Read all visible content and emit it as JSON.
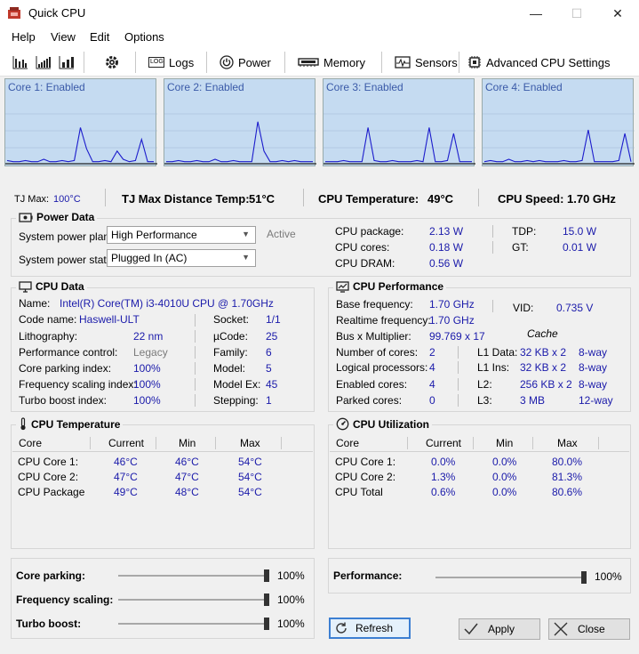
{
  "window": {
    "title": "Quick CPU",
    "minimize": "—",
    "maximize": "☐",
    "close": "✕"
  },
  "menu": [
    "Help",
    "View",
    "Edit",
    "Options"
  ],
  "toolbar": {
    "logs": "Logs",
    "power": "Power",
    "memory": "Memory",
    "sensors": "Sensors",
    "advanced": "Advanced CPU Settings",
    "log_badge": "LOG"
  },
  "cores": [
    {
      "label": "Core 1: Enabled",
      "load": [
        2,
        1,
        1,
        2,
        1,
        1,
        3,
        1,
        1,
        2,
        1,
        2,
        30,
        12,
        1,
        1,
        2,
        1,
        10,
        3,
        1,
        2,
        20,
        1,
        1
      ]
    },
    {
      "label": "Core 2: Enabled",
      "load": [
        1,
        1,
        2,
        1,
        1,
        2,
        1,
        1,
        3,
        1,
        1,
        2,
        1,
        1,
        1,
        35,
        10,
        1,
        1,
        2,
        1,
        2,
        1,
        1,
        1
      ]
    },
    {
      "label": "Core 3: Enabled",
      "load": [
        1,
        1,
        1,
        2,
        1,
        1,
        1,
        30,
        2,
        1,
        1,
        2,
        1,
        1,
        1,
        2,
        1,
        30,
        1,
        1,
        2,
        25,
        1,
        1,
        1
      ]
    },
    {
      "label": "Core 4: Enabled",
      "load": [
        1,
        2,
        1,
        1,
        3,
        1,
        1,
        2,
        1,
        2,
        1,
        1,
        1,
        2,
        1,
        1,
        2,
        28,
        1,
        1,
        1,
        1,
        2,
        25,
        1
      ]
    }
  ],
  "status": {
    "tjmax_label": "TJ Max:",
    "tjmax_value": "100°C",
    "tjdist_label": "TJ Max Distance Temp:",
    "tjdist_value": "51°C",
    "cputemp_label": "CPU Temperature:",
    "cputemp_value": "49°C",
    "cpuspeed_label": "CPU Speed:",
    "cpuspeed_value": "1.70 GHz"
  },
  "power": {
    "title": "Power Data",
    "plan_label": "System power plan:",
    "plan_value": "High Performance",
    "active": "Active",
    "state_label": "System power state:",
    "state_value": "Plugged In (AC)",
    "package_label": "CPU package:",
    "package_value": "2.13 W",
    "cores_label": "CPU cores:",
    "cores_value": "0.18 W",
    "dram_label": "CPU DRAM:",
    "dram_value": "0.56 W",
    "tdp_label": "TDP:",
    "tdp_value": "15.0 W",
    "gt_label": "GT:",
    "gt_value": "0.01 W"
  },
  "cpudata": {
    "title": "CPU Data",
    "name_label": "Name:",
    "name_value": "Intel(R) Core(TM) i3-4010U CPU @ 1.70GHz",
    "codename_label": "Code name:",
    "codename_value": "Haswell-ULT",
    "litho_label": "Lithography:",
    "litho_value": "22 nm",
    "perfctl_label": "Performance control:",
    "perfctl_value": "Legacy",
    "parking_label": "Core parking index:",
    "parking_value": "100%",
    "freq_label": "Frequency scaling index:",
    "freq_value": "100%",
    "turbo_label": "Turbo boost index:",
    "turbo_value": "100%",
    "socket_label": "Socket:",
    "socket_value": "1/1",
    "ucode_label": "µCode:",
    "ucode_value": "25",
    "family_label": "Family:",
    "family_value": "6",
    "model_label": "Model:",
    "model_value": "5",
    "modelex_label": "Model Ex:",
    "modelex_value": "45",
    "stepping_label": "Stepping:",
    "stepping_value": "1"
  },
  "perf": {
    "title": "CPU Performance",
    "base_label": "Base frequency:",
    "base_value": "1.70 GHz",
    "real_label": "Realtime frequency:",
    "real_value": "1.70 GHz",
    "bus_label": "Bus x Multiplier:",
    "bus_value": "99.769 x 17",
    "cores_label": "Number of cores:",
    "cores_value": "2",
    "logical_label": "Logical processors:",
    "logical_value": "4",
    "enabled_label": "Enabled cores:",
    "enabled_value": "4",
    "parked_label": "Parked cores:",
    "parked_value": "0",
    "vid_label": "VID:",
    "vid_value": "0.735 V",
    "cache_title": "Cache",
    "l1d_label": "L1 Data:",
    "l1d_value": "32 KB x 2",
    "l1d_way": "8-way",
    "l1i_label": "L1 Ins:",
    "l1i_value": "32 KB x 2",
    "l1i_way": "8-way",
    "l2_label": "L2:",
    "l2_value": "256 KB x 2",
    "l2_way": "8-way",
    "l3_label": "L3:",
    "l3_value": "3 MB",
    "l3_way": "12-way"
  },
  "temp": {
    "title": "CPU Temperature",
    "headers": [
      "Core",
      "Current",
      "Min",
      "Max"
    ],
    "rows": [
      [
        "CPU Core 1:",
        "46°C",
        "46°C",
        "54°C"
      ],
      [
        "CPU Core 2:",
        "47°C",
        "47°C",
        "54°C"
      ],
      [
        "CPU Package",
        "49°C",
        "48°C",
        "54°C"
      ]
    ]
  },
  "util": {
    "title": "CPU Utilization",
    "headers": [
      "Core",
      "Current",
      "Min",
      "Max"
    ],
    "rows": [
      [
        "CPU Core 1:",
        "0.0%",
        "0.0%",
        "80.0%"
      ],
      [
        "CPU Core 2:",
        "1.3%",
        "0.0%",
        "81.3%"
      ],
      [
        "CPU Total",
        "0.6%",
        "0.0%",
        "80.6%"
      ]
    ]
  },
  "sliders": {
    "parking_label": "Core parking:",
    "parking_value": "100%",
    "parking_level": 1.0,
    "freq_label": "Frequency scaling:",
    "freq_value": "100%",
    "freq_level": 1.0,
    "turbo_label": "Turbo boost:",
    "turbo_value": "100%",
    "turbo_level": 1.0,
    "perf_label": "Performance:",
    "perf_value": "100%",
    "perf_level": 1.0
  },
  "buttons": {
    "refresh": "Refresh",
    "apply": "Apply",
    "close": "Close"
  },
  "colors": {
    "graph_bg": "#c5dbf1",
    "graph_line": "#1c1ccc",
    "value_blue": "#1a1aaa",
    "focus_border": "#3c7fd2"
  }
}
